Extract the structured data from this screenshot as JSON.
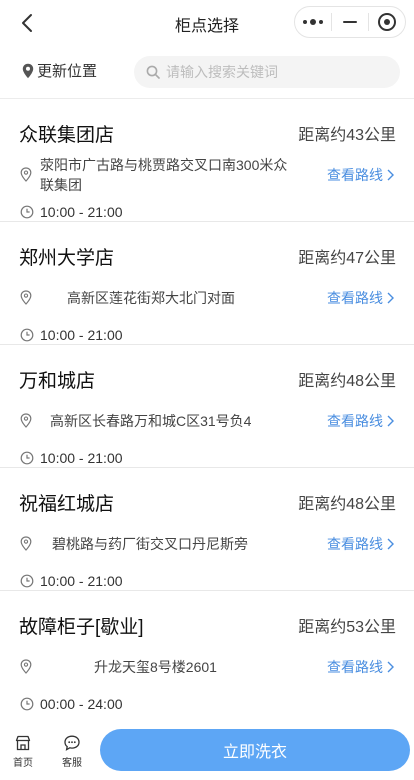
{
  "navbar": {
    "title": "柜点选择"
  },
  "search": {
    "location_label": "更新位置",
    "placeholder": "请输入搜索关键词"
  },
  "stores": [
    {
      "name": "众联集团店",
      "distance": "距离约43公里",
      "address": "荥阳市广古路与桃贾路交叉口南300米众联集团",
      "hours": "10:00 - 21:00",
      "route_label": "查看路线"
    },
    {
      "name": "郑州大学店",
      "distance": "距离约47公里",
      "address": "高新区莲花街郑大北门对面",
      "hours": "10:00 - 21:00",
      "route_label": "查看路线"
    },
    {
      "name": "万和城店",
      "distance": "距离约48公里",
      "address": "高新区长春路万和城C区31号负4",
      "hours": "10:00 - 21:00",
      "route_label": "查看路线"
    },
    {
      "name": "祝福红城店",
      "distance": "距离约48公里",
      "address": "碧桃路与药厂街交叉口丹尼斯旁",
      "hours": "10:00 - 21:00",
      "route_label": "查看路线"
    },
    {
      "name": "故障柜子[歇业]",
      "distance": "距离约53公里",
      "address": "升龙天玺8号楼2601",
      "hours": "00:00 - 24:00",
      "route_label": "查看路线"
    }
  ],
  "bottom_bar": {
    "home_label": "首页",
    "service_label": "客服",
    "wash_button": "立即洗衣"
  },
  "colors": {
    "accent": "#4a8ee0",
    "button": "#5da6f5"
  }
}
